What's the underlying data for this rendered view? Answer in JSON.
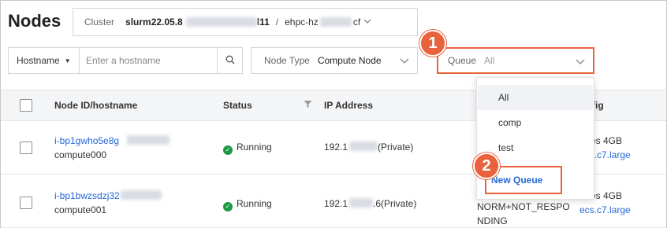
{
  "page": {
    "title": "Nodes"
  },
  "cluster": {
    "label": "Cluster",
    "value_prefix": "slurm22.05.8",
    "value_mid": "l11",
    "separator": "/",
    "value_suffix_a": "ehpc-hz",
    "value_suffix_b": "cf"
  },
  "filters": {
    "hostname_select": "Hostname",
    "hostname_placeholder": "Enter a hostname",
    "node_type_label": "Node Type",
    "node_type_value": "Compute Node",
    "queue_label": "Queue",
    "queue_value": "All"
  },
  "callouts": {
    "one": "1",
    "two": "2"
  },
  "table": {
    "headers": {
      "node": "Node ID/hostname",
      "status": "Status",
      "ip": "IP Address",
      "config": "fig"
    },
    "rows": [
      {
        "id": "i-bp1gwho5e8g",
        "hostname": "compute000",
        "status": "Running",
        "ip_prefix": "192.1",
        "ip_suffix": "(Private)",
        "state": "",
        "state2": "",
        "config": "...res 4GB",
        "instance": "ecs.c7.large"
      },
      {
        "id": "i-bp1bwzsdzj32",
        "hostname": "compute001",
        "status": "Running",
        "ip_prefix": "192.1",
        "ip_suffix": ".6(Private)",
        "state": "NORM+NOT_RESPO",
        "state2": "NDING",
        "config": "...res 4GB",
        "instance": "ecs.c7.large"
      }
    ]
  },
  "queue_dropdown": {
    "options": [
      "All",
      "comp",
      "test"
    ],
    "new_queue": "New Queue"
  },
  "colors": {
    "accent": "#e8623d",
    "link": "#2468d6",
    "running": "#1e9a44"
  }
}
